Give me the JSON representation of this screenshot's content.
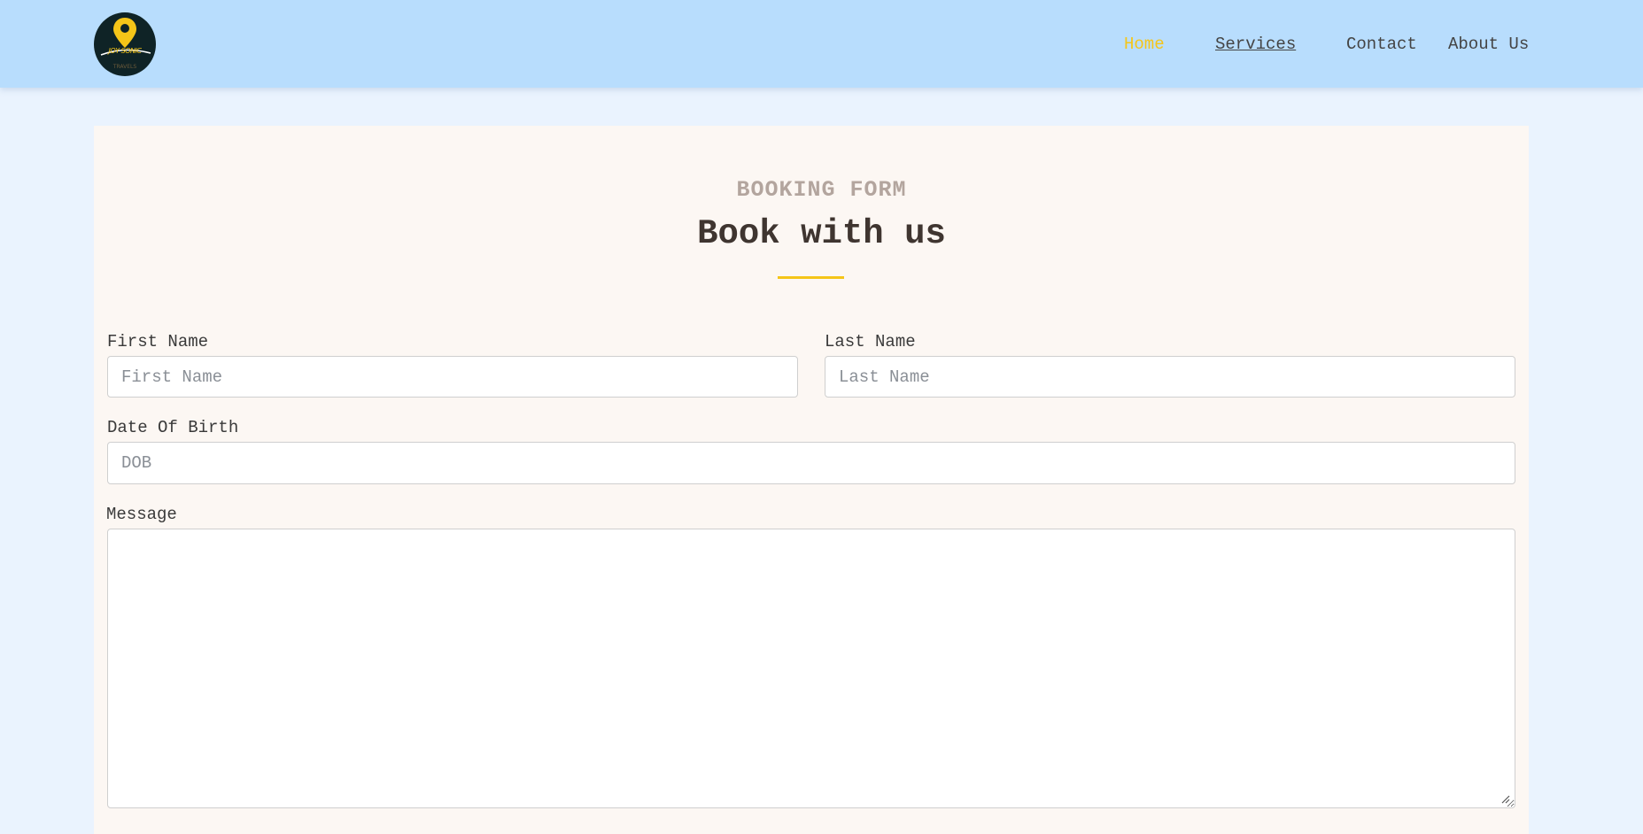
{
  "header": {
    "logo_text": "JOY SONIC",
    "logo_subtext": "TRAVELS"
  },
  "nav": {
    "items": [
      {
        "label": "Home",
        "active": true
      },
      {
        "label": "Services",
        "active": false
      },
      {
        "label": "Contact",
        "active": false
      },
      {
        "label": "About Us",
        "active": false
      }
    ]
  },
  "form": {
    "eyebrow": "BOOKING FORM",
    "title": "Book with us",
    "fields": {
      "first_name": {
        "label": "First Name",
        "placeholder": "First Name",
        "value": ""
      },
      "last_name": {
        "label": "Last Name",
        "placeholder": "Last Name",
        "value": ""
      },
      "dob": {
        "label": "Date Of Birth",
        "placeholder": "DOB",
        "value": ""
      },
      "message": {
        "label": "Message",
        "placeholder": "",
        "value": ""
      }
    }
  },
  "colors": {
    "header_bg": "#b8ddfd",
    "page_bg": "#eaf3fe",
    "card_bg": "#fcf7f3",
    "accent": "#f5c518",
    "eyebrow": "#b3a59e",
    "title": "#3f3530"
  }
}
